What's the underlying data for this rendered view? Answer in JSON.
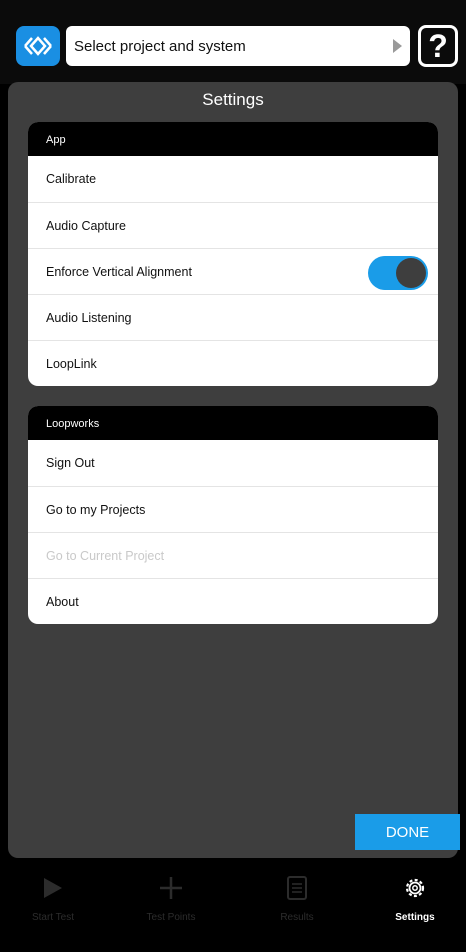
{
  "header": {
    "project_select_value": "Select project and system",
    "help_label": "?"
  },
  "panel": {
    "title": "Settings",
    "done_label": "DONE"
  },
  "sections": [
    {
      "header": "App",
      "items": [
        {
          "label": "Calibrate"
        },
        {
          "label": "Audio Capture"
        },
        {
          "label": "Enforce Vertical Alignment",
          "toggle": true
        },
        {
          "label": "Audio Listening"
        },
        {
          "label": "LoopLink"
        }
      ]
    },
    {
      "header": "Loopworks",
      "items": [
        {
          "label": "Sign Out"
        },
        {
          "label": "Go to my Projects"
        },
        {
          "label": "Go to Current Project",
          "disabled": true
        },
        {
          "label": "About"
        }
      ]
    }
  ],
  "tabs": [
    {
      "label": "Start Test",
      "icon": "play-icon"
    },
    {
      "label": "Test Points",
      "icon": "plus-icon"
    },
    {
      "label": "Results",
      "icon": "document-icon"
    },
    {
      "label": "Settings",
      "icon": "gear-icon",
      "active": true
    }
  ],
  "colors": {
    "accent": "#1a9ce8",
    "panel": "#3e3e3e",
    "section_header": "#000000"
  }
}
